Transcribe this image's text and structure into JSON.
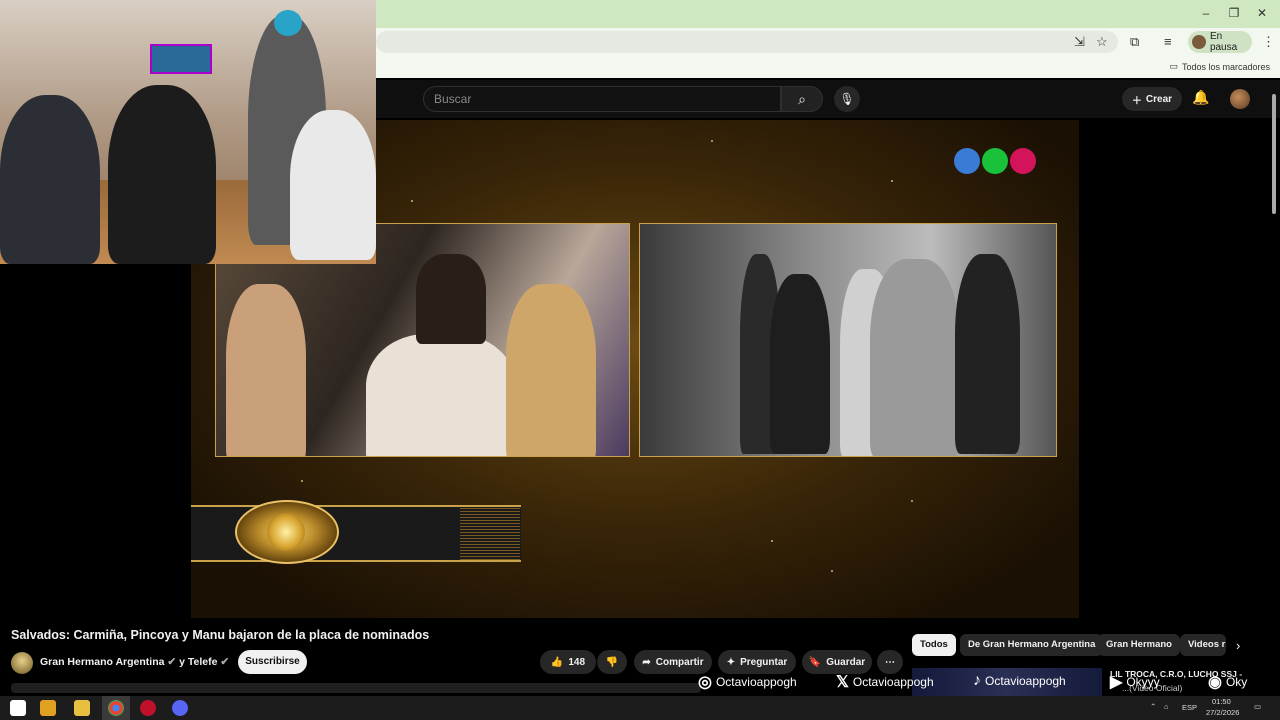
{
  "browser": {
    "profile_status": "En pausa",
    "bookmarks_all": "Todos los marcadores"
  },
  "youtube": {
    "search_placeholder": "Buscar",
    "create_label": "Crear",
    "video_title": "Salvados: Carmiña, Pincoya y Manu bajaron de la placa de nominados",
    "channel_name": "Gran Hermano Argentina",
    "channel_connector": "y Telefe",
    "subscribe_label": "Suscribirse",
    "like_count": "148",
    "share_label": "Compartir",
    "ask_label": "Preguntar",
    "save_label": "Guardar",
    "chips": [
      "Todos",
      "De Gran Hermano Argentina",
      "Gran Hermano",
      "Videos r"
    ],
    "related_title": "LIL TROCA, C.R.O, LUCHO SSJ -",
    "related_sub": "...(Video Oficial)"
  },
  "socials": [
    {
      "icon": "instagram-icon",
      "handle": "Octavioappogh"
    },
    {
      "icon": "x-icon",
      "handle": "Octavioappogh"
    },
    {
      "icon": "tiktok-icon",
      "handle": "Octavioappogh"
    },
    {
      "icon": "youtube-icon",
      "handle": "Okyyy"
    },
    {
      "icon": "spotify-icon",
      "handle": "Oky"
    }
  ],
  "taskbar": {
    "lang": "ESP",
    "time": "01:50",
    "date": "27/2/2026"
  },
  "colors": {
    "telefe_blue": "#3a7bd5",
    "telefe_green": "#19c23a",
    "telefe_red": "#d4145a",
    "gold": "#c9a24a"
  }
}
